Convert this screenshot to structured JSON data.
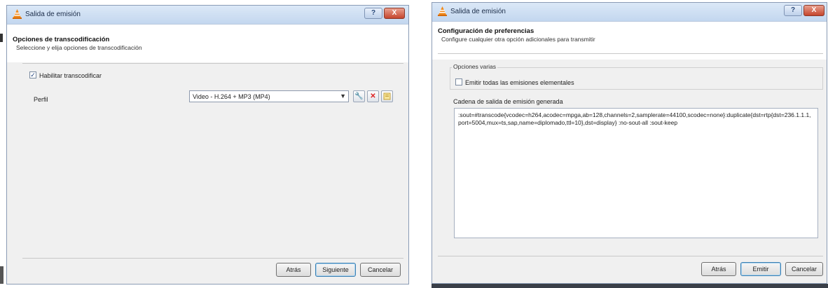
{
  "left_window": {
    "title": "Salida de emisión",
    "help_symbol": "?",
    "close_symbol": "X",
    "header_title": "Opciones de transcodificación",
    "header_subtitle": "Seleccione y elija opciones de transcodificación",
    "transcode_checkbox": {
      "label": "Habilitar transcodificar",
      "checked": true
    },
    "profile_label": "Perfil",
    "profile_value": "Video - H.264 + MP3 (MP4)",
    "buttons": {
      "back": "Atrás",
      "next": "Siguiente",
      "cancel": "Cancelar"
    }
  },
  "right_window": {
    "title": "Salida de emisión",
    "help_symbol": "?",
    "close_symbol": "X",
    "header_title": "Configuración de preferencias",
    "header_subtitle": "Configure cualquier otra opción adicionales para transmitir",
    "misc_group_title": "Opciones varias",
    "all_streams_checkbox": {
      "label": "Emitir todas las emisiones elementales",
      "checked": false
    },
    "output_group_title": "Cadena de salida de emisión generada",
    "output_string": ":sout=#transcode{vcodec=h264,acodec=mpga,ab=128,channels=2,samplerate=44100,scodec=none}:duplicate{dst=rtp{dst=236.1.1.1,port=5004,mux=ts,sap,name=diplomado,ttl=10},dst=display} :no-sout-all :sout-keep",
    "buttons": {
      "back": "Atrás",
      "stream": "Emitir",
      "cancel": "Cancelar"
    }
  },
  "icons": {
    "vlc": "vlc-cone-icon",
    "edit_profile": "wrench-icon",
    "delete_profile": "red-x-icon",
    "new_profile": "new-profile-icon"
  },
  "colors": {
    "titlebar": "#c3d7ef",
    "close": "#c5452c",
    "window_bg": "#f0f0f0"
  }
}
